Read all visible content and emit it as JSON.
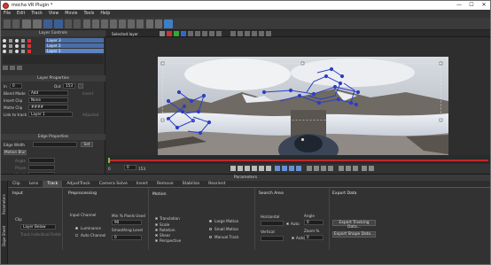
{
  "window": {
    "title": "mocha VR Plugin *",
    "minimize": "—",
    "maximize": "☐",
    "close": "✕"
  },
  "menu": [
    "File",
    "Edit",
    "Track",
    "View",
    "Movie",
    "Tools",
    "Help"
  ],
  "layer_controls": {
    "header": "Layer Controls",
    "layers": [
      {
        "name": "Layer 3",
        "color": "#e03030"
      },
      {
        "name": "Layer 2",
        "color": "#e03030"
      },
      {
        "name": "Layer 1",
        "color": "#e03030"
      }
    ]
  },
  "layer_properties": {
    "header": "Layer Properties",
    "in_label": "In",
    "in_value": "0",
    "out_label": "Out",
    "out_value": "153",
    "blend_mode_label": "Blend Mode",
    "blend_mode_value": "Add",
    "insert_clip_label": "Insert Clip",
    "insert_clip_value": "None",
    "matte_clip_label": "Matte Clip",
    "matte_clip_value": "####",
    "link_to_track_label": "Link to track",
    "link_to_track_value": "Layer 1",
    "invert_label": "Invert",
    "adjusted_label": "Adjusted"
  },
  "edge_properties": {
    "header": "Edge Properties",
    "edge_width_label": "Edge Width",
    "set_label": "Set",
    "motion_blur_label": "Motion Blur",
    "angle_label": "Angle",
    "phase_label": "Phase",
    "quality_label": "Quality"
  },
  "viewer": {
    "layer_select": "Selected layer",
    "frame_label": "153"
  },
  "panels": {
    "parameters": "Parameters"
  },
  "tabs": [
    "Clip",
    "Lens",
    "Track",
    "AdjustTrack",
    "Camera Solve",
    "Insert",
    "Remove",
    "Stabilize",
    "Reorient"
  ],
  "active_tab": "Track",
  "side_tabs": [
    "Parameters",
    "Dope Sheet"
  ],
  "input": {
    "title": "Input",
    "clip_label": "Clip",
    "clip_value": "Layer Below",
    "track_individual_fields": "Track Individual Fields"
  },
  "preprocessing": {
    "title": "Preprocessing",
    "input_channel_label": "Input Channel",
    "luminance": "Luminance",
    "auto_channel": "Auto Channel",
    "min_pixels_label": "Min % Pixels Used",
    "min_pixels_value": "90",
    "smoothing_label": "Smoothing Level",
    "smoothing_value": "0"
  },
  "motion": {
    "title": "Motion",
    "options": [
      "Translation",
      "Scale",
      "Rotation",
      "Shear",
      "Perspective"
    ],
    "large_motion": "Large Motion",
    "small_motion": "Small Motion",
    "manual_track": "Manual Track"
  },
  "search_area": {
    "title": "Search Area",
    "horizontal_label": "Horizontal",
    "vertical_label": "Vertical",
    "auto_label": "Auto",
    "angle_label": "Angle",
    "angle_value": "0",
    "zoom_label": "Zoom %",
    "zoom_value": "0",
    "auto2_label": "Auto"
  },
  "export_data": {
    "title": "Export Data",
    "export_tracking": "Export Tracking Data...",
    "export_shape": "Export Shape Data..."
  }
}
